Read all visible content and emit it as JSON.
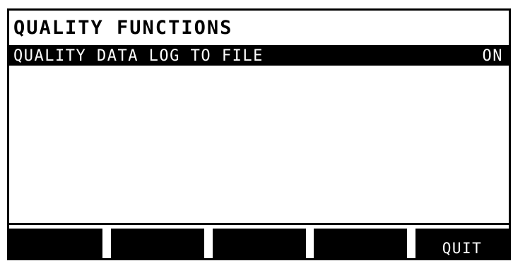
{
  "header": {
    "title": "QUALITY FUNCTIONS"
  },
  "menu": {
    "items": [
      {
        "label": "QUALITY DATA LOG TO FILE",
        "value": "ON",
        "selected": true
      }
    ]
  },
  "softkeys": [
    {
      "label": ""
    },
    {
      "label": ""
    },
    {
      "label": ""
    },
    {
      "label": ""
    },
    {
      "label": "QUIT"
    }
  ]
}
